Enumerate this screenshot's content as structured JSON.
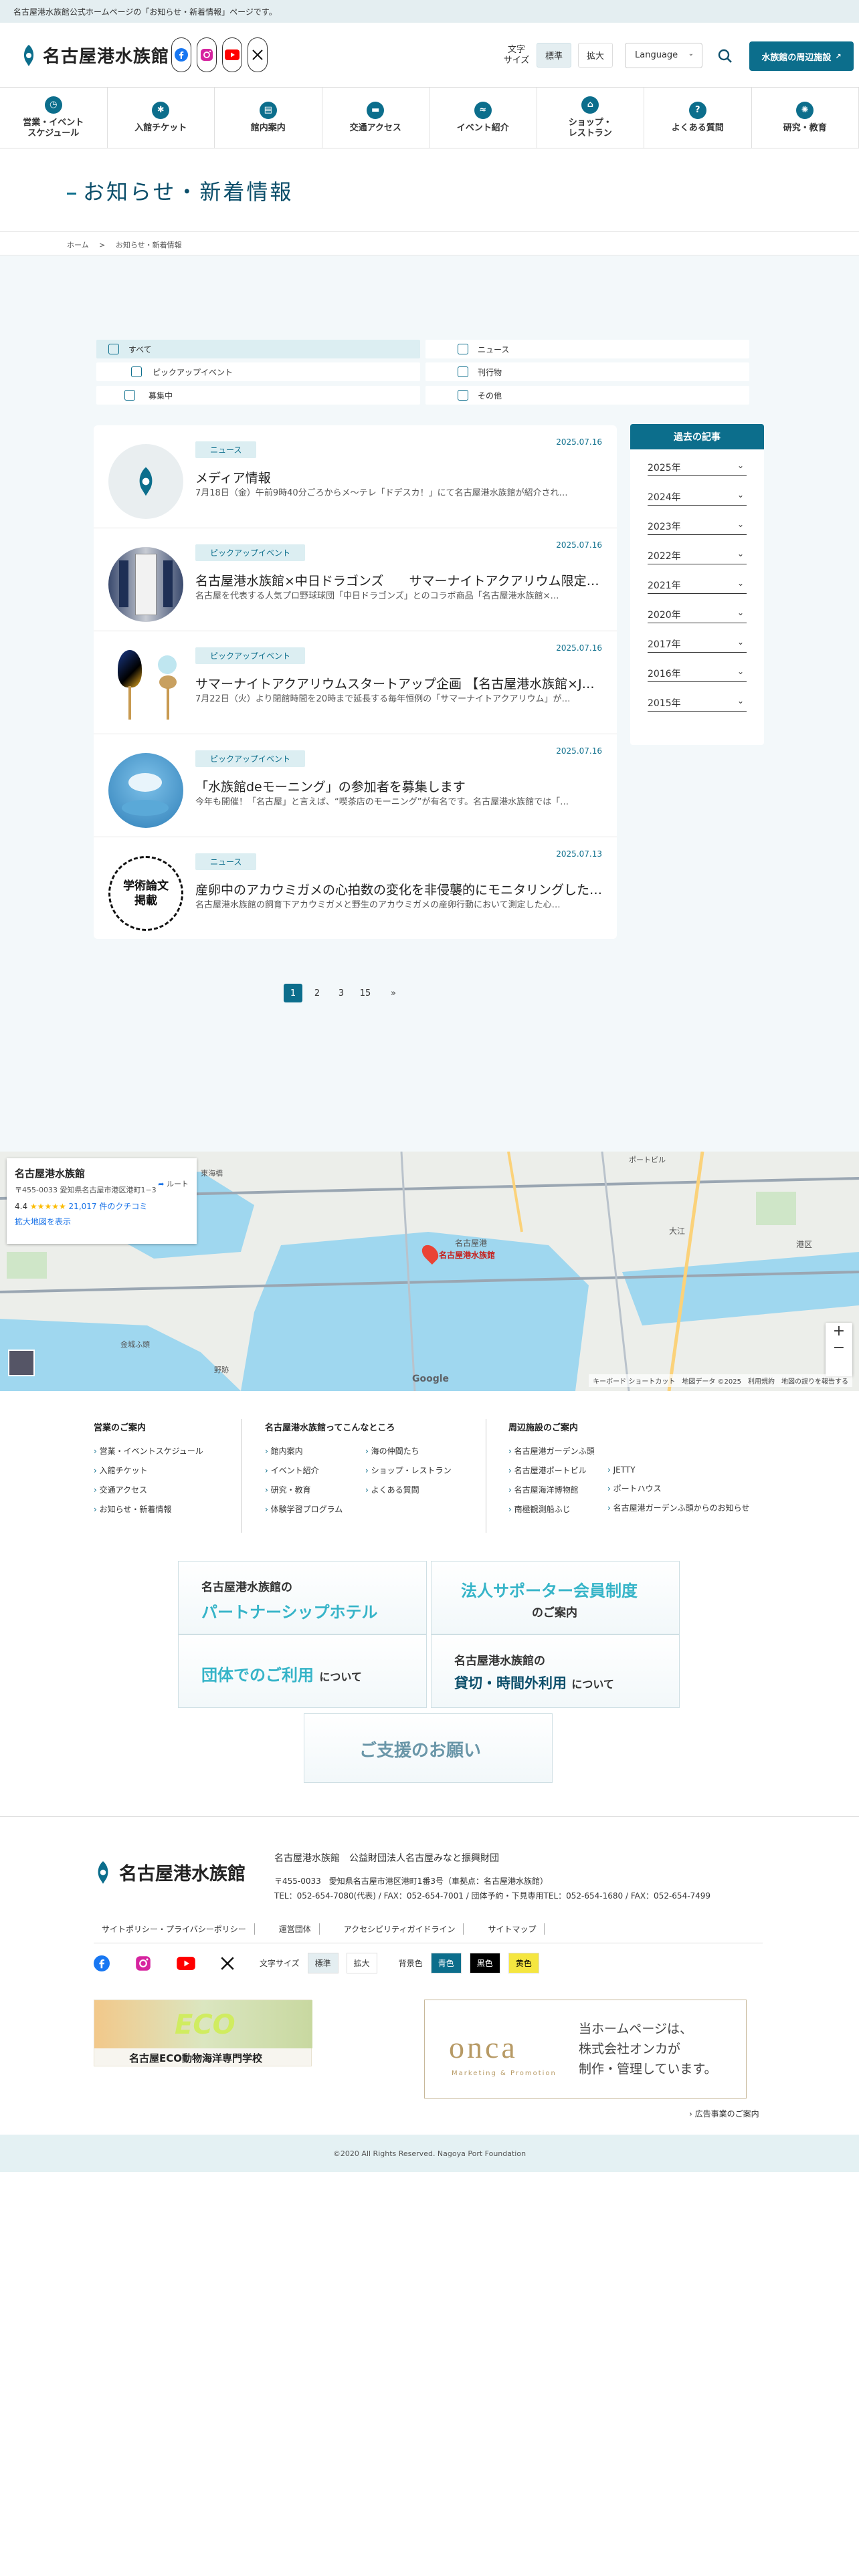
{
  "notice": "名古屋港水族館公式ホームページの「お知らせ・新着情報」ページです。",
  "header": {
    "logo_text": "名古屋港水族館",
    "font_size_label": "文字\nサイズ",
    "font_standard": "標準",
    "font_large": "拡大",
    "language": "Language",
    "nearby_button": "水族館の周辺施設"
  },
  "gnav": [
    {
      "label": "営業・イベント\nスケジュール",
      "icon": "clock-icon"
    },
    {
      "label": "入館チケット",
      "icon": "ticket-icon"
    },
    {
      "label": "館内案内",
      "icon": "map-icon"
    },
    {
      "label": "交通アクセス",
      "icon": "bus-icon"
    },
    {
      "label": "イベント紹介",
      "icon": "dolphin-icon"
    },
    {
      "label": "ショップ・\nレストラン",
      "icon": "shop-icon"
    },
    {
      "label": "よくある質問",
      "icon": "question-icon"
    },
    {
      "label": "研究・教育",
      "icon": "research-icon"
    }
  ],
  "page_title": "お知らせ・新着情報",
  "breadcrumb": [
    "ホーム",
    ">",
    "お知らせ・新着情報"
  ],
  "categories": [
    {
      "label": "すべて",
      "active": true
    },
    {
      "label": "ニュース",
      "active": false
    },
    {
      "label": "ピックアップイベント",
      "active": false
    },
    {
      "label": "刊行物",
      "active": false
    },
    {
      "label": "募集中",
      "active": false
    },
    {
      "label": "その他",
      "active": false
    }
  ],
  "articles": [
    {
      "date": "2025.07.16",
      "category": "ニュース",
      "title": "メディア情報",
      "desc": "7月18日（金）午前9時40分ごろからメ～テレ「ドデスカ！」にて名古屋港水族館が紹介され…"
    },
    {
      "date": "2025.07.16",
      "category": "ピックアップイベント",
      "title": "名古屋港水族館×中日ドラゴンズ　　サマーナイトアクアリウム限定…",
      "desc": "名古屋を代表する人気プロ野球球団「中日ドラゴンズ」とのコラボ商品「名古屋港水族館×…"
    },
    {
      "date": "2025.07.16",
      "category": "ピックアップイベント",
      "title": "サマーナイトアクアリウムスタートアップ企画 【名古屋港水族館×J…",
      "desc": "7月22日（火）より閉館時間を20時まで延長する毎年恒例の「サマーナイトアクアリウム」が…"
    },
    {
      "date": "2025.07.16",
      "category": "ピックアップイベント",
      "title": "「水族館deモーニング」の参加者を募集します",
      "desc": "今年も開催！「名古屋」と言えば、“喫茶店のモーニング”が有名です。名古屋港水族館では「…"
    },
    {
      "date": "2025.07.13",
      "category": "ニュース",
      "title": "産卵中のアカウミガメの心拍数の変化を非侵襲的にモニタリングした…",
      "desc": "名古屋港水族館の飼育下アカウミガメと野生のアカウミガメの産卵行動において測定した心…"
    }
  ],
  "thumb5_text": "学術論文\n掲載",
  "archive": {
    "title": "過去の記事",
    "years": [
      "2025年",
      "2024年",
      "2023年",
      "2022年",
      "2021年",
      "2020年",
      "2017年",
      "2016年",
      "2015年"
    ]
  },
  "pagination": [
    "1",
    "2",
    "3",
    "15",
    "»"
  ],
  "map": {
    "name": "名古屋港水族館",
    "address": "〒455-0033 愛知県名古屋市港区港町1−3",
    "route": "ルート",
    "rating": "4.4",
    "stars": "★★★★★",
    "reviews": "21,017 件のクチコミ",
    "enlarge": "拡大地図を表示",
    "pin_label": "名古屋港水族館",
    "footer": "キーボード ショートカット　地図データ ©2025　利用規約　地図の誤りを報告する",
    "labels": [
      "大江",
      "名古屋港",
      "港区",
      "ポートビル",
      "金城ふ頭",
      "野跡",
      "東海橋"
    ]
  },
  "footer_sections": [
    {
      "title": "営業のご案内",
      "items": [
        "営業・イベントスケジュール",
        "入館チケット",
        "交通アクセス",
        "お知らせ・新着情報"
      ]
    },
    {
      "title": "名古屋港水族館ってこんなところ",
      "items": [
        "館内案内",
        "イベント紹介",
        "研究・教育",
        "体験学習プログラム"
      ],
      "items2": [
        "海の仲間たち",
        "ショップ・レストラン",
        "よくある質問"
      ]
    },
    {
      "title": "周辺施設のご案内",
      "items": [
        "名古屋港ガーデンふ頭",
        "名古屋港ポートビル",
        "名古屋海洋博物館",
        "南極観測船ふじ"
      ],
      "items2": [
        "JETTY",
        "ポートハウス",
        "名古屋港ガーデンふ頭からのお知らせ"
      ]
    }
  ],
  "banners": [
    {
      "l1": "名古屋港水族館の",
      "l2": "パートナーシップホテル",
      "l3": ""
    },
    {
      "l1": "",
      "l2": "法人サポーター会員制度",
      "l3": "のご案内"
    },
    {
      "l1": "",
      "l2": "団体でのご利用",
      "l3": "について"
    },
    {
      "l1": "名古屋港水族館の",
      "l2": "貸切・時間外利用",
      "l3": "について"
    },
    {
      "l1": "",
      "l2": "ご支援のお願い",
      "l3": ""
    }
  ],
  "footer": {
    "logo_text": "名古屋港水族館",
    "org": "名古屋港水族館　公益財団法人名古屋みなと振興財団",
    "addr1": "〒455-0033　愛知県名古屋市港区港町1番3号（車拠点：名古屋港水族館）",
    "addr2": "TEL：052-654-7080(代表) / FAX：052-654-7001 / 団体予約・下見専用TEL：052-654-1680 / FAX：052-654-7499",
    "links": [
      "サイトポリシー・プライバシーポリシー",
      "運営団体",
      "アクセシビリティガイドライン",
      "サイトマップ"
    ],
    "font_size": "文字サイズ",
    "font_standard": "標準",
    "font_large": "拡大",
    "bg_color": "背景色",
    "bg_options": [
      "青色",
      "黒色",
      "黄色"
    ],
    "eco_school": "名古屋ECO動物海洋専門学校",
    "onca_logo": "onca",
    "onca_sub": "Marketing & Promotion",
    "onca_text": "当ホームページは、\n株式会社オンカが\n制作・管理しています。",
    "ad_guide": "広告事業のご案内",
    "copyright": "©2020 All Rights Reserved. Nagoya Port Foundation"
  },
  "colors": {
    "primary": "#0c6e8c",
    "accent_light": "#dceef2",
    "banner_text": "#36b4c8"
  }
}
